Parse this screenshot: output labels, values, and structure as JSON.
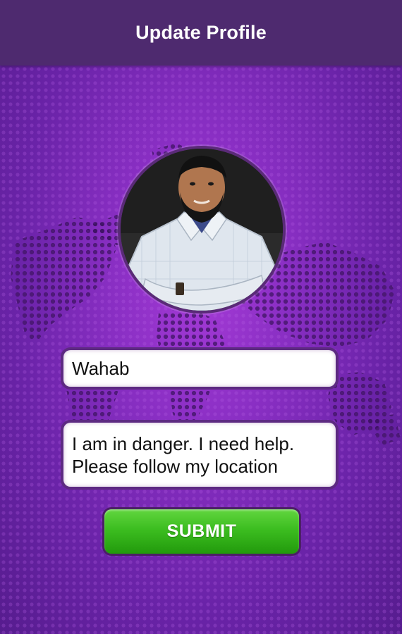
{
  "header": {
    "title": "Update Profile"
  },
  "profile": {
    "photo_icon": "user-photo"
  },
  "form": {
    "name_value": "Wahab",
    "message_value": "I am in danger. I need help.\nPlease follow my location",
    "submit_label": "SUBMIT"
  },
  "colors": {
    "app_bar": "#4e2a6f",
    "background": "#8a2fc4",
    "submit_button": "#3cbd20"
  }
}
